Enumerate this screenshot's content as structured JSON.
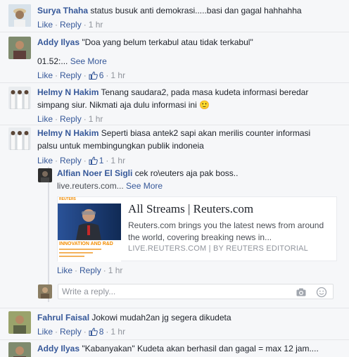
{
  "comments": [
    {
      "name": "Surya Thaha",
      "text": "status busuk anti demokrasi.....basi dan gagal hahhahha",
      "like": "Like",
      "reply": "Reply",
      "time": "1 hr"
    },
    {
      "name": "Addy Ilyas",
      "text": "\"Doa yang belum terkabul atau tidak terkabul\"",
      "text2": "01.52:...",
      "see_more": "See More",
      "like": "Like",
      "reply": "Reply",
      "likes": "6",
      "time": "1 hr"
    },
    {
      "name": "Helmy N Hakim",
      "text": "Tenang saudara2, pada masa kudeta informasi beredar",
      "text2": "simpang siur. Nikmati aja dulu informasi ini",
      "emoji": "🙂",
      "like": "Like",
      "reply": "Reply",
      "time": "1 hr"
    },
    {
      "name": "Helmy N Hakim",
      "text": "Seperti biasa antek2 sapi akan merilis counter informasi",
      "text2": "palsu untuk membingungkan publik indoneia",
      "like": "Like",
      "reply": "Reply",
      "likes": "1",
      "time": "1 hr"
    },
    {
      "name": "Fahrul Faisal",
      "text": "Jokowi mudah2an jg segera dikudeta",
      "like": "Like",
      "reply": "Reply",
      "likes": "8",
      "time": "1 hr"
    },
    {
      "name": "Addy Ilyas",
      "text": "\"Kabanyakan\" Kudeta akan berhasil dan gagal = max 12 jam...."
    }
  ],
  "nested_reply": {
    "name": "Alfian Noer El Sigli",
    "text": "cek ro\\euters aja pak boss..",
    "link_text": "live.reuters.com...",
    "see_more": "See More",
    "like": "Like",
    "reply": "Reply",
    "time": "1 hr"
  },
  "link_preview": {
    "title": "All Streams | Reuters.com",
    "description": "Reuters.com brings you the latest news from around the world, covering breaking news in...",
    "source": "LIVE.REUTERS.COM | BY REUTERS EDITORIAL",
    "image_caption": "INNOVATION AND R&D",
    "image_logo": "REUTERS"
  },
  "reply_box": {
    "placeholder": "Write a reply..."
  },
  "icons": {
    "camera": "camera-icon",
    "sticker": "smiley-icon",
    "like": "thumbs-up-icon"
  },
  "colors": {
    "link": "#365899",
    "muted": "#90949c",
    "background": "#f6f7f9"
  }
}
